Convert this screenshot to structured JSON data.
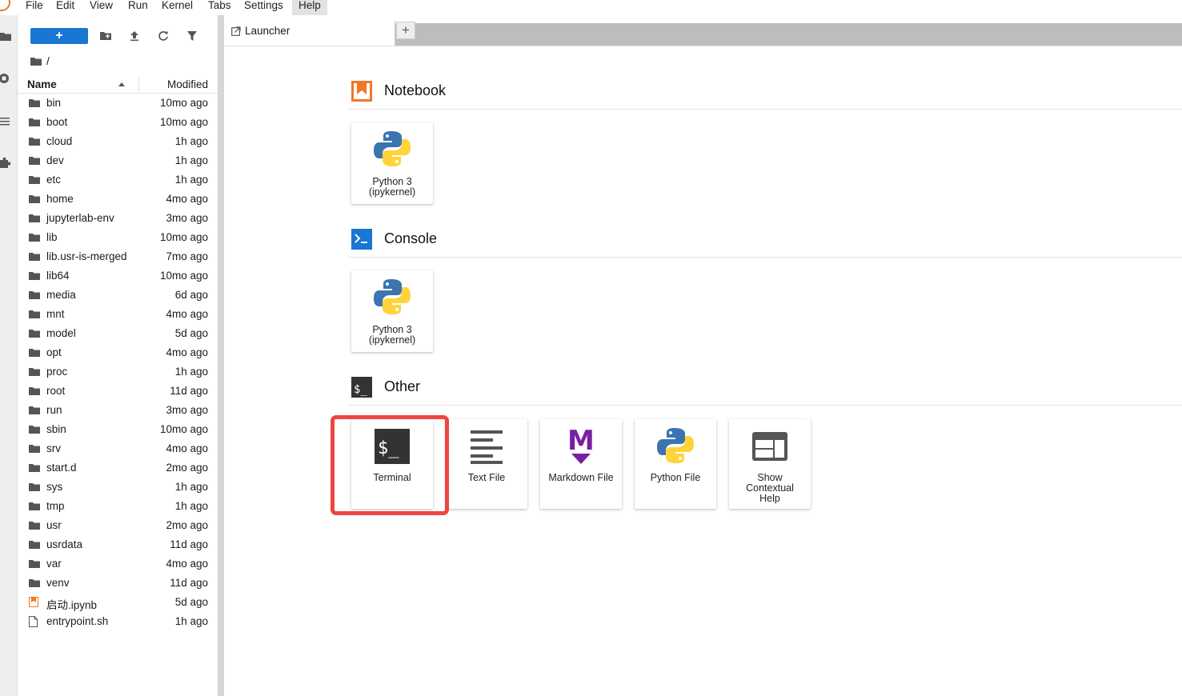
{
  "menubar": {
    "items": [
      {
        "label": "File"
      },
      {
        "label": "Edit"
      },
      {
        "label": "View"
      },
      {
        "label": "Run"
      },
      {
        "label": "Kernel"
      },
      {
        "label": "Tabs"
      },
      {
        "label": "Settings"
      },
      {
        "label": "Help",
        "active": true
      }
    ]
  },
  "filebrowser": {
    "new_label": "+",
    "breadcrumb": "/",
    "columns": {
      "name": "Name",
      "modified": "Modified"
    },
    "files": [
      {
        "name": "bin",
        "modified": "10mo ago",
        "type": "folder"
      },
      {
        "name": "boot",
        "modified": "10mo ago",
        "type": "folder"
      },
      {
        "name": "cloud",
        "modified": "1h ago",
        "type": "folder"
      },
      {
        "name": "dev",
        "modified": "1h ago",
        "type": "folder"
      },
      {
        "name": "etc",
        "modified": "1h ago",
        "type": "folder"
      },
      {
        "name": "home",
        "modified": "4mo ago",
        "type": "folder"
      },
      {
        "name": "jupyterlab-env",
        "modified": "3mo ago",
        "type": "folder"
      },
      {
        "name": "lib",
        "modified": "10mo ago",
        "type": "folder"
      },
      {
        "name": "lib.usr-is-merged",
        "modified": "7mo ago",
        "type": "folder"
      },
      {
        "name": "lib64",
        "modified": "10mo ago",
        "type": "folder"
      },
      {
        "name": "media",
        "modified": "6d ago",
        "type": "folder"
      },
      {
        "name": "mnt",
        "modified": "4mo ago",
        "type": "folder"
      },
      {
        "name": "model",
        "modified": "5d ago",
        "type": "folder"
      },
      {
        "name": "opt",
        "modified": "4mo ago",
        "type": "folder"
      },
      {
        "name": "proc",
        "modified": "1h ago",
        "type": "folder"
      },
      {
        "name": "root",
        "modified": "11d ago",
        "type": "folder"
      },
      {
        "name": "run",
        "modified": "3mo ago",
        "type": "folder"
      },
      {
        "name": "sbin",
        "modified": "10mo ago",
        "type": "folder"
      },
      {
        "name": "srv",
        "modified": "4mo ago",
        "type": "folder"
      },
      {
        "name": "start.d",
        "modified": "2mo ago",
        "type": "folder"
      },
      {
        "name": "sys",
        "modified": "1h ago",
        "type": "folder"
      },
      {
        "name": "tmp",
        "modified": "1h ago",
        "type": "folder"
      },
      {
        "name": "usr",
        "modified": "2mo ago",
        "type": "folder"
      },
      {
        "name": "usrdata",
        "modified": "11d ago",
        "type": "folder"
      },
      {
        "name": "var",
        "modified": "4mo ago",
        "type": "folder"
      },
      {
        "name": "venv",
        "modified": "11d ago",
        "type": "folder"
      },
      {
        "name": "启动.ipynb",
        "modified": "5d ago",
        "type": "notebook"
      },
      {
        "name": "entrypoint.sh",
        "modified": "1h ago",
        "type": "file"
      }
    ]
  },
  "tabs": {
    "launcher_label": "Launcher",
    "add_label": "+"
  },
  "launcher": {
    "sections": {
      "notebook": {
        "title": "Notebook",
        "cards": [
          {
            "label1": "Python 3",
            "label2": "(ipykernel)"
          }
        ]
      },
      "console": {
        "title": "Console",
        "cards": [
          {
            "label1": "Python 3",
            "label2": "(ipykernel)"
          }
        ]
      },
      "other": {
        "title": "Other",
        "cards": [
          {
            "label": "Terminal"
          },
          {
            "label": "Text File"
          },
          {
            "label": "Markdown File"
          },
          {
            "label": "Python File"
          },
          {
            "label1": "Show",
            "label2": "Contextual",
            "label3": "Help"
          }
        ]
      }
    }
  },
  "colors": {
    "accent_blue": "#1976d2",
    "notebook_orange": "#f37726",
    "markdown_purple": "#7b1fa2",
    "highlight_red": "#ef4444"
  }
}
